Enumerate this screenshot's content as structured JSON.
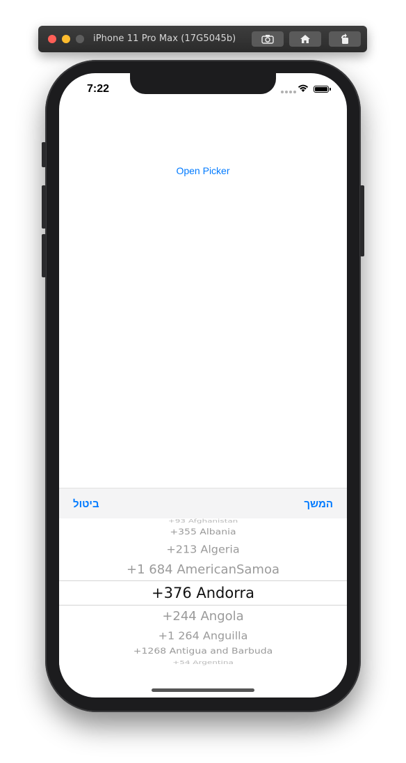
{
  "simulator": {
    "title": "iPhone 11 Pro Max (17G5045b)",
    "buttons": [
      "camera-icon",
      "home-icon",
      "rotate-icon"
    ]
  },
  "status_bar": {
    "time": "7:22"
  },
  "main": {
    "open_picker_label": "Open Picker"
  },
  "toolbar": {
    "cancel_label": "ביטול",
    "continue_label": "המשך"
  },
  "picker": {
    "items": [
      "+93 Afghanistan",
      "+355 Albania",
      "+213 Algeria",
      "+1 684 AmericanSamoa",
      "+376 Andorra",
      "+244 Angola",
      "+1 264 Anguilla",
      "+1268 Antigua and Barbuda",
      "+54 Argentina"
    ],
    "selected_index": 4
  },
  "colors": {
    "accent": "#007aff",
    "toolbar_bg": "#f4f4f5",
    "phone_frame": "#1c1c1e"
  }
}
